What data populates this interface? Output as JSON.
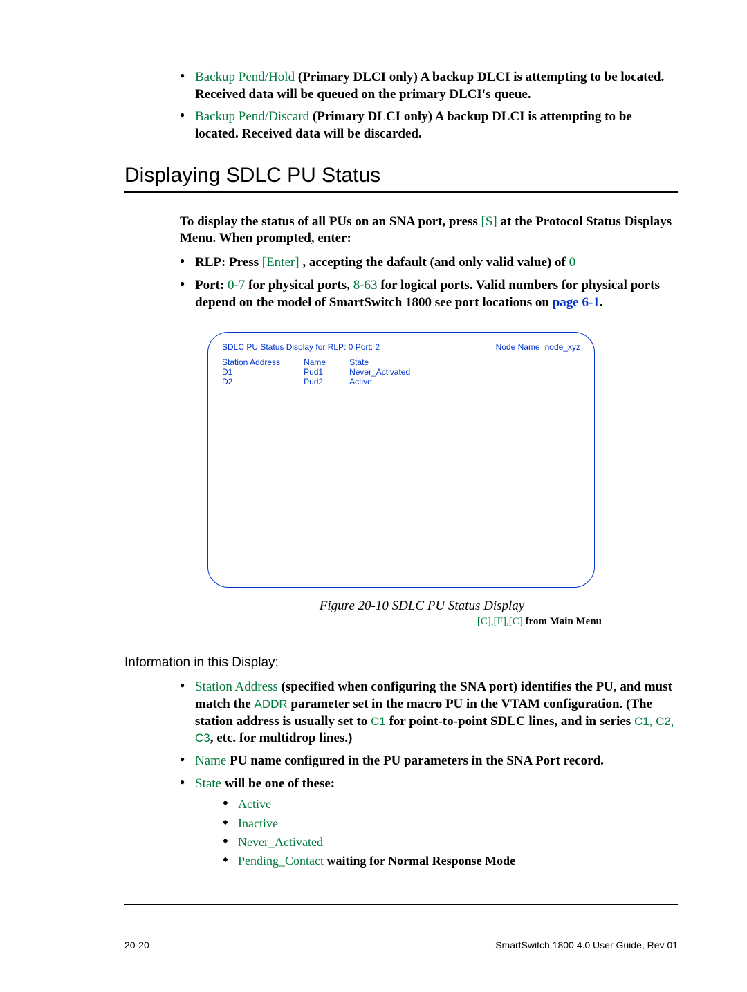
{
  "top_bullets": [
    {
      "term": "Backup Pend/Hold",
      "desc": " (Primary DLCI only) A backup DLCI is attempting to be located. Received data will be queued on the primary DLCI's queue."
    },
    {
      "term": "Backup Pend/Discard",
      "desc": " (Primary DLCI only) A backup DLCI is attempting to be located. Received data will be discarded."
    }
  ],
  "section_title": "Displaying SDLC PU Status",
  "intro_a": "To display the status of all PUs on an SNA port, press ",
  "intro_key": "[S]",
  "intro_b": " at the Protocol Status Displays Menu. When prompted, enter:",
  "rlp_bullet": {
    "a": "RLP: Press ",
    "key": "[Enter]",
    "b": " , accepting the dafault (and only valid value) of ",
    "c": "0"
  },
  "port_bullet": {
    "a": "Port: ",
    "r1": "0-7",
    "b": " for physical ports, ",
    "r2": "8-63",
    "c": " for logical ports. Valid numbers for physical ports depend on the model of SmartSwitch 1800 see port locations on ",
    "link": "page 6-1",
    "d": "."
  },
  "figure": {
    "title_line": "SDLC PU Status Display for RLP: 0    Port: 2",
    "node": "Node Name=node_xyz",
    "col1_h": "Station Address",
    "col1_r1": "D1",
    "col1_r2": "D2",
    "col2_h": "Name",
    "col2_r1": "Pud1",
    "col2_r2": "Pud2",
    "col3_h": "State",
    "col3_r1": "Never_Activated",
    "col3_r2": "Active"
  },
  "figure_caption": "Figure 20-10    SDLC PU Status Display",
  "figure_sub_path": "[C],[F],[C]",
  "figure_sub_rest": " from Main Menu",
  "info_heading": "Information in this Display:",
  "info_bullets": {
    "sa_term": "Station Address",
    "sa_a": " (specified when configuring the SNA port) identifies the PU, and must match the ",
    "sa_addr": "ADDR",
    "sa_b": " parameter set in the macro PU in the VTAM configuration. (The station address is usually set to ",
    "sa_c1": "C1",
    "sa_c": " for point-to-point SDLC lines, and in series ",
    "sa_series": "C1, C2, C3",
    "sa_d": ", etc. for multidrop lines.)",
    "name_term": "Name",
    "name_desc": " PU name configured in the PU parameters in the SNA Port record.",
    "state_term": "State",
    "state_desc": " will be one of these:",
    "states": {
      "s1": "Active",
      "s2": "Inactive",
      "s3": "Never_Activated",
      "s4": "Pending_Contact",
      "s4_desc": " waiting for Normal Response Mode"
    }
  },
  "footer_left": "20-20",
  "footer_right": "SmartSwitch 1800 4.0 User Guide, Rev 01"
}
